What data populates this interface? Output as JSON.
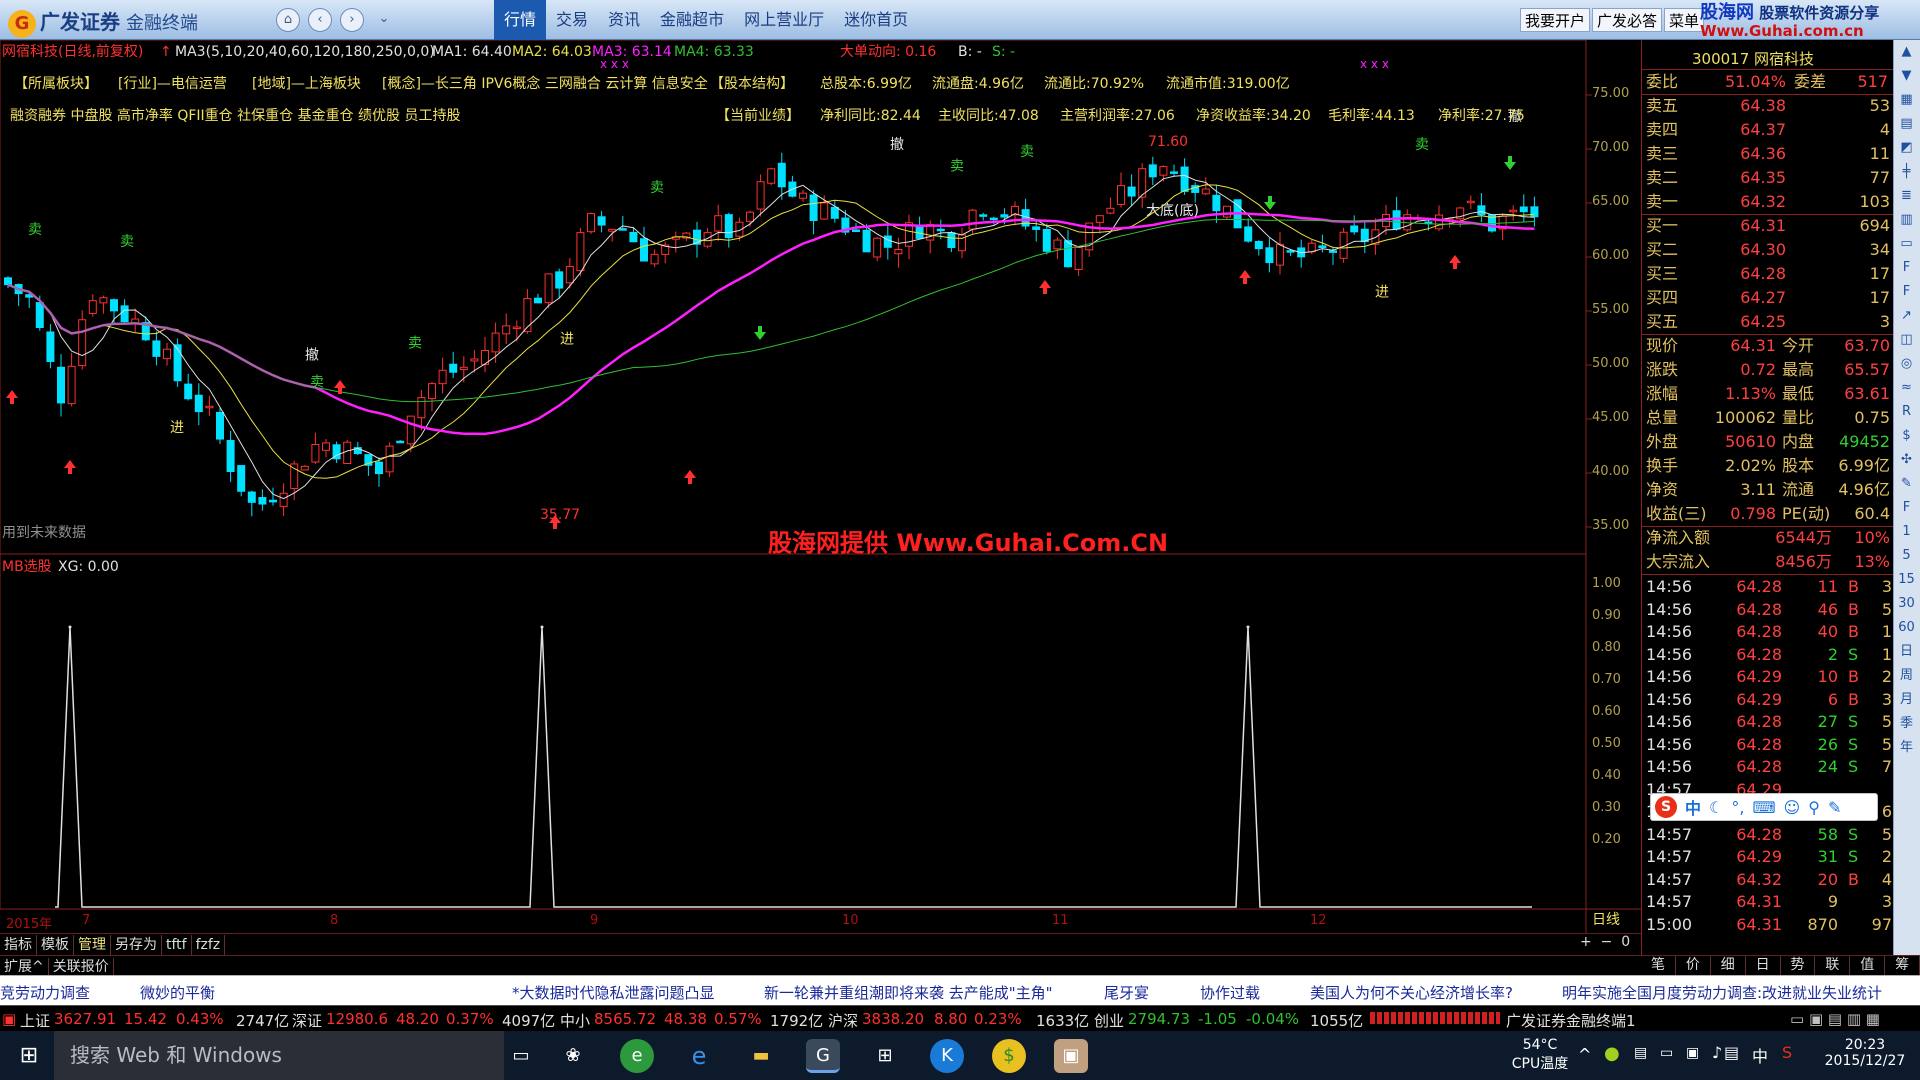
{
  "app": {
    "logo": "广发证券",
    "logo_sub": "金融终端",
    "tabs": [
      "行情",
      "交易",
      "资讯",
      "金融超市",
      "网上营业厅",
      "迷你首页"
    ],
    "active_tab": "行情",
    "right_buttons": [
      "我要开户",
      "广发必答",
      "菜单"
    ]
  },
  "watermark_top": {
    "line1": "股海网",
    "line2": "股票软件资源分享",
    "line3": "Www.Guhai.com.cn"
  },
  "chart_header": {
    "title": "网宿科技(日线,前复权)",
    "ma3_params": "MA3(5,10,20,40,60,120,180,250,0,0)",
    "ma1": "MA1: 64.40",
    "ma2": "MA2: 64.03",
    "ma3": "MA3: 63.14",
    "ma4": "MA4: 63.33",
    "big_order": "大单动向: 0.16",
    "b": "B: -",
    "s": "S: -"
  },
  "info_line1": [
    "【所属板块】",
    "[行业]—电信运营",
    "[地域]—上海板块",
    "[概念]—长三角 IPV6概念 三网融合 云计算 信息安全",
    "【股本结构】",
    "总股本:6.99亿",
    "流通盘:4.96亿",
    "流通比:70.92%",
    "流通市值:319.00亿"
  ],
  "info_line2": [
    "融资融券 中盘股 高市净率 QFII重仓 社保重仓 基金重仓 绩优股 员工持股",
    "【当前业绩】",
    "净利同比:82.44",
    "主收同比:47.08",
    "主营利润率:27.06",
    "净资收益率:34.20",
    "毛利率:44.13",
    "净利率:27.75"
  ],
  "annotations": {
    "high": "71.60",
    "low": "35.77",
    "future": "用到未来数据",
    "big_bottom": "大底(底)",
    "jin": "进",
    "che": "撤",
    "mai": "卖"
  },
  "main_y_axis": [
    "75.00",
    "70.00",
    "65.00",
    "60.00",
    "55.00",
    "50.00",
    "45.00",
    "40.00",
    "35.00"
  ],
  "sub_chart": {
    "title": "MB选股",
    "value": "XG: 0.00",
    "y_axis": [
      "1.00",
      "0.90",
      "0.80",
      "0.70",
      "0.60",
      "0.50",
      "0.40",
      "0.30",
      "0.20"
    ]
  },
  "x_axis": {
    "year": "2015年",
    "months": [
      "7",
      "8",
      "9",
      "10",
      "11",
      "12"
    ],
    "period": "日线"
  },
  "chart_data": {
    "type": "line",
    "title": "MB选股",
    "ylim": [
      0,
      1
    ],
    "series": [
      {
        "name": "XG",
        "x": [
          "2015-07",
          "2015-08-28",
          "2015-12-01"
        ],
        "values": [
          1,
          1,
          1
        ]
      }
    ]
  },
  "bottom_tabs": [
    "指标",
    "模板",
    "管理",
    "另存为",
    "tftf",
    "fzfz"
  ],
  "bottom_tabs2": [
    "扩展^",
    "关联报价"
  ],
  "quote": {
    "code": "300017",
    "name": "网宿科技",
    "weibi": [
      "委比",
      "51.04%",
      "委差",
      "517"
    ],
    "sells": [
      [
        "卖五",
        "64.38",
        "53"
      ],
      [
        "卖四",
        "64.37",
        "4"
      ],
      [
        "卖三",
        "64.36",
        "11"
      ],
      [
        "卖二",
        "64.35",
        "77"
      ],
      [
        "卖一",
        "64.32",
        "103"
      ]
    ],
    "buys": [
      [
        "买一",
        "64.31",
        "694"
      ],
      [
        "买二",
        "64.30",
        "34"
      ],
      [
        "买三",
        "64.28",
        "17"
      ],
      [
        "买四",
        "64.27",
        "17"
      ],
      [
        "买五",
        "64.25",
        "3"
      ]
    ],
    "stats": [
      [
        "现价",
        "64.31",
        "今开",
        "63.70"
      ],
      [
        "涨跌",
        "0.72",
        "最高",
        "65.57"
      ],
      [
        "涨幅",
        "1.13%",
        "最低",
        "63.61"
      ],
      [
        "总量",
        "100062",
        "量比",
        "0.75"
      ],
      [
        "外盘",
        "50610",
        "内盘",
        "49452"
      ],
      [
        "换手",
        "2.02%",
        "股本",
        "6.99亿"
      ],
      [
        "净资",
        "3.11",
        "流通",
        "4.96亿"
      ],
      [
        "收益(三)",
        "0.798",
        "PE(动)",
        "60.4"
      ]
    ],
    "flows": [
      [
        "净流入额",
        "6544万",
        "10%"
      ],
      [
        "大宗流入",
        "8456万",
        "13%"
      ]
    ],
    "ticks": [
      [
        "14:56",
        "64.28",
        "11",
        "B",
        "3"
      ],
      [
        "14:56",
        "64.28",
        "46",
        "B",
        "5"
      ],
      [
        "14:56",
        "64.28",
        "40",
        "B",
        "1"
      ],
      [
        "14:56",
        "64.28",
        "2",
        "S",
        "1"
      ],
      [
        "14:56",
        "64.29",
        "10",
        "B",
        "2"
      ],
      [
        "14:56",
        "64.29",
        "6",
        "B",
        "3"
      ],
      [
        "14:56",
        "64.28",
        "27",
        "S",
        "5"
      ],
      [
        "14:56",
        "64.28",
        "26",
        "S",
        "5"
      ],
      [
        "14:56",
        "64.28",
        "24",
        "S",
        "7"
      ],
      [
        "14:57",
        "64.29",
        "",
        "",
        ""
      ],
      [
        "14:57",
        "64.29",
        "1",
        "S",
        "6"
      ],
      [
        "14:57",
        "64.28",
        "58",
        "S",
        "5"
      ],
      [
        "14:57",
        "64.29",
        "31",
        "S",
        "2"
      ],
      [
        "14:57",
        "64.32",
        "20",
        "B",
        "4"
      ],
      [
        "14:57",
        "64.31",
        "9",
        "",
        "3"
      ],
      [
        "15:00",
        "64.31",
        "870",
        "",
        "97"
      ]
    ],
    "panel_tabs": [
      "笔",
      "价",
      "细",
      "日",
      "势",
      "联",
      "值",
      "筹"
    ]
  },
  "news": [
    "竞劳动力调查",
    "微妙的平衡",
    "*大数据时代隐私泄露问题凸显",
    "新一轮兼并重组潮即将来袭 去产能成\"主角\"",
    "尾牙宴",
    "协作过载",
    "美国人为何不关心经济增长率?",
    "明年实施全国月度劳动力调查:改进就业失业统计"
  ],
  "ticker": {
    "sh": [
      "上证",
      "3627.91",
      "15.42",
      "0.43%",
      "2747亿"
    ],
    "sz": [
      "深证",
      "12980.6",
      "48.20",
      "0.37%",
      "4097亿"
    ],
    "zx": [
      "中小",
      "8565.72",
      "48.38",
      "0.57%",
      "1792亿"
    ],
    "hs": [
      "沪深",
      "3838.20",
      "8.80",
      "0.23%",
      "1633亿"
    ],
    "cy": [
      "创业",
      "2794.73",
      "-1.05",
      "-0.04%",
      "1055亿"
    ],
    "label": "广发证券金融终端1"
  },
  "taskbar": {
    "search": "搜索 Web 和 Windows",
    "temp": "54°C",
    "cpu": "CPU温度",
    "time": "20:23",
    "date": "2015/12/27",
    "ime": "中"
  },
  "center_watermark": "股海网提供 Www.Guhai.Com.CN",
  "colors": {
    "up": "#ff3030",
    "down": "#00e0ff",
    "ma_magenta": "#ff20ff",
    "ma_yellow": "#e8e040",
    "ma_green": "#30c030"
  }
}
